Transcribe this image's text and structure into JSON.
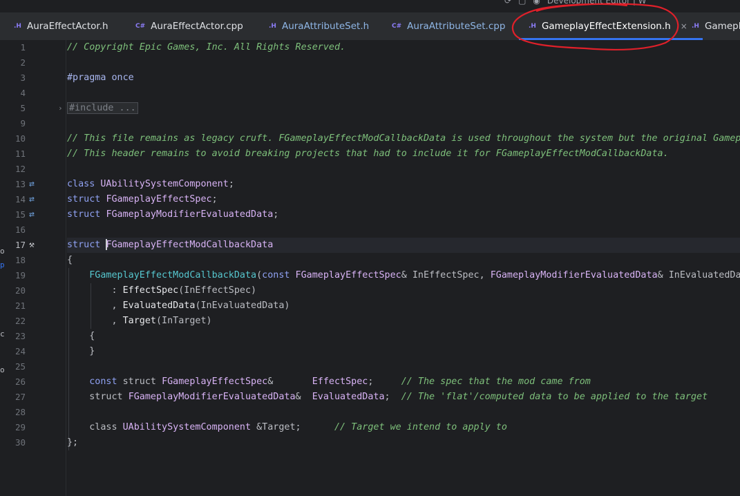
{
  "top": {
    "right_text": "Development Editor | W"
  },
  "tabs": [
    {
      "type": ".H",
      "label": "AuraEffectActor.h",
      "active": false
    },
    {
      "type": "C#",
      "label": "AuraEffectActor.cpp",
      "active": false
    },
    {
      "type": ".H",
      "label": "AuraAttributeSet.h",
      "active": false
    },
    {
      "type": "C#",
      "label": "AuraAttributeSet.cpp",
      "active": false
    },
    {
      "type": ".H",
      "label": "GameplayEffectExtension.h",
      "active": true,
      "close": "×"
    },
    {
      "type": ".H",
      "label": "Gamepla",
      "active": false
    }
  ],
  "line_numbers": [
    "1",
    "2",
    "3",
    "4",
    "5",
    "9",
    "10",
    "11",
    "12",
    "13",
    "14",
    "15",
    "16",
    "17",
    "18",
    "19",
    "20",
    "21",
    "22",
    "23",
    "24",
    "25",
    "26",
    "27",
    "28",
    "29",
    "30"
  ],
  "code": {
    "l1": "// Copyright Epic Games, Inc. All Rights Reserved.",
    "l3_kw": "#pragma",
    "l3_rest": " once",
    "l5_folded": "#include ...",
    "l10": "// This file remains as legacy cruft. FGameplayEffectModCallbackData is used throughout the system but the original Gamepl",
    "l11": "// This header remains to avoid breaking projects that had to include it for FGameplayEffectModCallbackData.",
    "l13_kw": "class",
    "l13_ty": "UAbilitySystemComponent",
    "l14_kw": "struct",
    "l14_ty": "FGameplayEffectSpec",
    "l15_kw": "struct",
    "l15_ty": "FGameplayModifierEvaluatedData",
    "l17_kw": "struct",
    "l17_ty": "FGameplayEffectModCallbackData",
    "l18": "{",
    "l19_ctor": "FGameplayEffectModCallbackData",
    "l19_kw": "const",
    "l19_t1": "FGameplayEffectSpec",
    "l19_p1": "& InEffectSpec, ",
    "l19_t2": "FGameplayModifierEvaluatedData",
    "l19_p2": "& InEvaluatedDat",
    "l20_a": ": ",
    "l20_f": "EffectSpec",
    "l20_b": "(InEffectSpec)",
    "l21_a": ", ",
    "l21_f": "EvaluatedData",
    "l21_b": "(InEvaluatedData)",
    "l22_a": ", ",
    "l22_f": "Target",
    "l22_b": "(InTarget)",
    "l23": "{",
    "l24": "}",
    "l26_kw": "const",
    "l26_kw2": " struct ",
    "l26_ty": "FGameplayEffectSpec",
    "l26_amp": "&       ",
    "l26_f": "EffectSpec",
    "l26_semi": ";     ",
    "l26_cm": "// The spec that the mod came from",
    "l27_kw": "struct ",
    "l27_ty": "FGameplayModifierEvaluatedData",
    "l27_amp": "&  ",
    "l27_f": "EvaluatedData",
    "l27_semi": ";  ",
    "l27_cm": "// The 'flat'/computed data to be applied to the target",
    "l29_kw": "class ",
    "l29_ty": "UAbilitySystemComponent",
    "l29_rest": " &Target;      ",
    "l29_cm": "// Target we intend to apply to",
    "l30": "};"
  },
  "icons": {
    "impl": "implements-icon",
    "hammer": "build-hammer-icon",
    "fold": "fold-chevron-icon"
  },
  "colors": {
    "accent": "#3574f0",
    "annotation": "#e0202a"
  }
}
